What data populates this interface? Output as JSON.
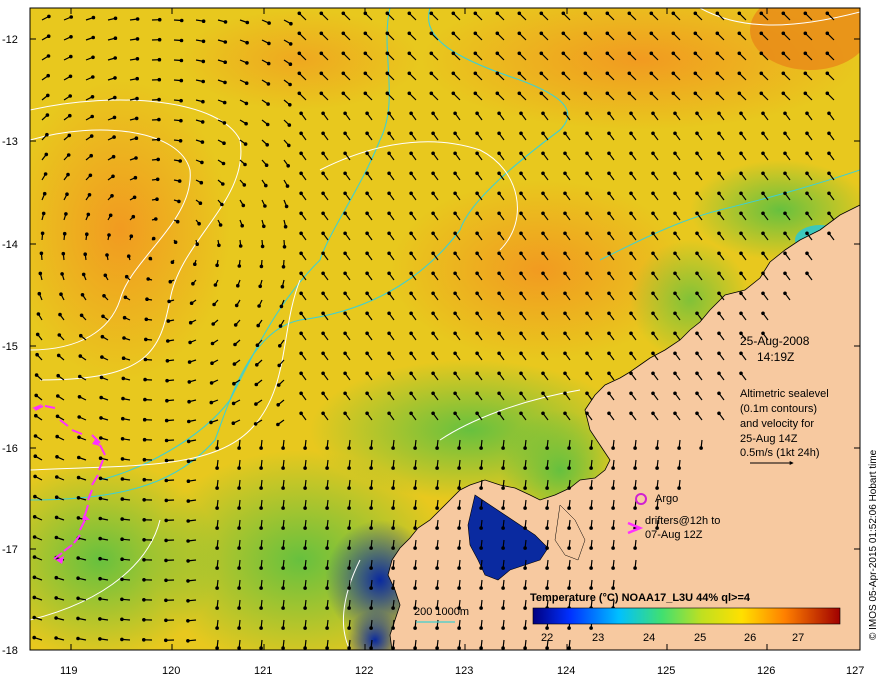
{
  "map": {
    "date": "25-Aug-2008",
    "time": "14:19Z",
    "altimetry_note": [
      "Altimetric sealevel",
      "(0.1m contours)",
      "and velocity for",
      "25-Aug 14Z"
    ],
    "velocity_scale": "0.5m/s (1kt 24h)",
    "argo_label": "Argo",
    "drifters_label_line1": "drifters@12h to",
    "drifters_label_line2": "07-Aug 12Z",
    "depth_legend": "200  1000m",
    "colorbar_title": "Temperature (°C) NOAA17_L3U 44% ql>=4",
    "colorbar_ticks": [
      "22",
      "23",
      "24",
      "25",
      "26",
      "27"
    ],
    "credit": "© IMOS 05-Apr-2015 01:52:06 Hobart time",
    "lat_ticks": [
      "-12",
      "-13",
      "-14",
      "-15",
      "-16",
      "-17",
      "-18"
    ],
    "lon_ticks": [
      "119",
      "120",
      "121",
      "122",
      "123",
      "124",
      "125",
      "126",
      "127"
    ],
    "colors": {
      "land": "#f7c9a0",
      "warm_sst": "#f0a020",
      "mid_sst": "#e6d020",
      "cool_sst": "#70c840",
      "cold_sst": "#1030a0",
      "isobath": "#40d0d0",
      "drifter": "#ff30ff",
      "argo": "#d020d0"
    }
  }
}
